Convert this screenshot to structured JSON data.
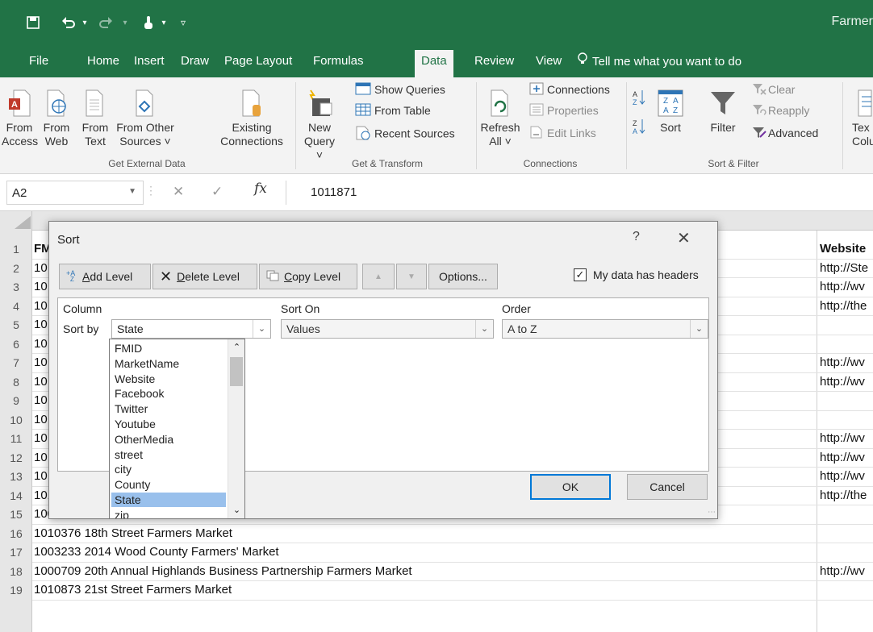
{
  "app": {
    "title": "Farmer"
  },
  "quick_access": {
    "icons": [
      "save-icon",
      "undo-icon",
      "redo-icon",
      "customize-icon"
    ]
  },
  "tabs": [
    "File",
    "Home",
    "Insert",
    "Draw",
    "Page Layout",
    "Formulas",
    "Data",
    "Review",
    "View"
  ],
  "active_tab": "Data",
  "tell_me": "Tell me what you want to do",
  "ribbon": {
    "get_external_data": {
      "group_label": "Get External Data",
      "from_access": [
        "From",
        "Access"
      ],
      "from_web": [
        "From",
        "Web"
      ],
      "from_text": [
        "From",
        "Text"
      ],
      "from_other": [
        "From Other",
        "Sources ˅"
      ],
      "existing": [
        "Existing",
        "Connections"
      ]
    },
    "get_transform": {
      "group_label": "Get & Transform",
      "new_query": [
        "New",
        "Query ˅"
      ],
      "show_queries": "Show Queries",
      "from_table": "From Table",
      "recent_sources": "Recent Sources"
    },
    "connections": {
      "group_label": "Connections",
      "refresh": [
        "Refresh",
        "All ˅"
      ],
      "connections": "Connections",
      "properties": "Properties",
      "edit_links": "Edit Links"
    },
    "sort_filter": {
      "group_label": "Sort & Filter",
      "sort": "Sort",
      "filter": "Filter",
      "clear": "Clear",
      "reapply": "Reapply",
      "advanced": "Advanced"
    },
    "text_to_columns": [
      "Tex",
      "Colu"
    ]
  },
  "formula_bar": {
    "name_box": "A2",
    "fx": "fx",
    "value": "1011871"
  },
  "sheet": {
    "col_a_header_partial": "FM",
    "website_header": "Website",
    "rows": [
      {
        "n": "1",
        "a": "",
        "w": ""
      },
      {
        "n": "2",
        "a": "10",
        "w": "http://Ste"
      },
      {
        "n": "3",
        "a": "10",
        "w": "http://wv"
      },
      {
        "n": "4",
        "a": "10",
        "w": "http://the"
      },
      {
        "n": "5",
        "a": "10",
        "w": ""
      },
      {
        "n": "6",
        "a": "10",
        "w": ""
      },
      {
        "n": "7",
        "a": "10",
        "w": "http://wv"
      },
      {
        "n": "8",
        "a": "10",
        "w": "http://wv"
      },
      {
        "n": "9",
        "a": "10",
        "w": ""
      },
      {
        "n": "10",
        "a": "10",
        "w": ""
      },
      {
        "n": "11",
        "a": "10",
        "w": "http://wv"
      },
      {
        "n": "12",
        "a": "10",
        "w": "http://wv"
      },
      {
        "n": "13",
        "a": "10",
        "w": "http://wv"
      },
      {
        "n": "14",
        "a": "1010968 18th and Christian Farmers' Market",
        "w": "http://the"
      },
      {
        "n": "15",
        "a": "1009994 18th Street Farmer's Market",
        "w": ""
      },
      {
        "n": "16",
        "a": "1010376 18th Street Farmers Market",
        "w": ""
      },
      {
        "n": "17",
        "a": "1003233 2014 Wood County Farmers' Market",
        "w": ""
      },
      {
        "n": "18",
        "a": "1000709 20th Annual Highlands Business Partnership Farmers Market",
        "w": "http://wv"
      },
      {
        "n": "19",
        "a": "1010873 21st Street Farmers Market",
        "w": ""
      }
    ]
  },
  "dialog": {
    "title": "Sort",
    "help": "?",
    "add_level": "Add Level",
    "add_level_key": "A",
    "delete_level": "Delete Level",
    "delete_level_key": "D",
    "copy_level": "Copy Level",
    "copy_level_key": "C",
    "options": "Options...",
    "headers_label": "My data has headers",
    "headers_checked": true,
    "col_header": "Column",
    "sorton_header": "Sort On",
    "order_header": "Order",
    "sort_by": "Sort by",
    "column_value": "State",
    "sorton_value": "Values",
    "order_value": "A to Z",
    "dropdown_options": [
      "FMID",
      "MarketName",
      "Website",
      "Facebook",
      "Twitter",
      "Youtube",
      "OtherMedia",
      "street",
      "city",
      "County",
      "State",
      "zip"
    ],
    "dropdown_selected": "State",
    "ok": "OK",
    "cancel": "Cancel"
  }
}
